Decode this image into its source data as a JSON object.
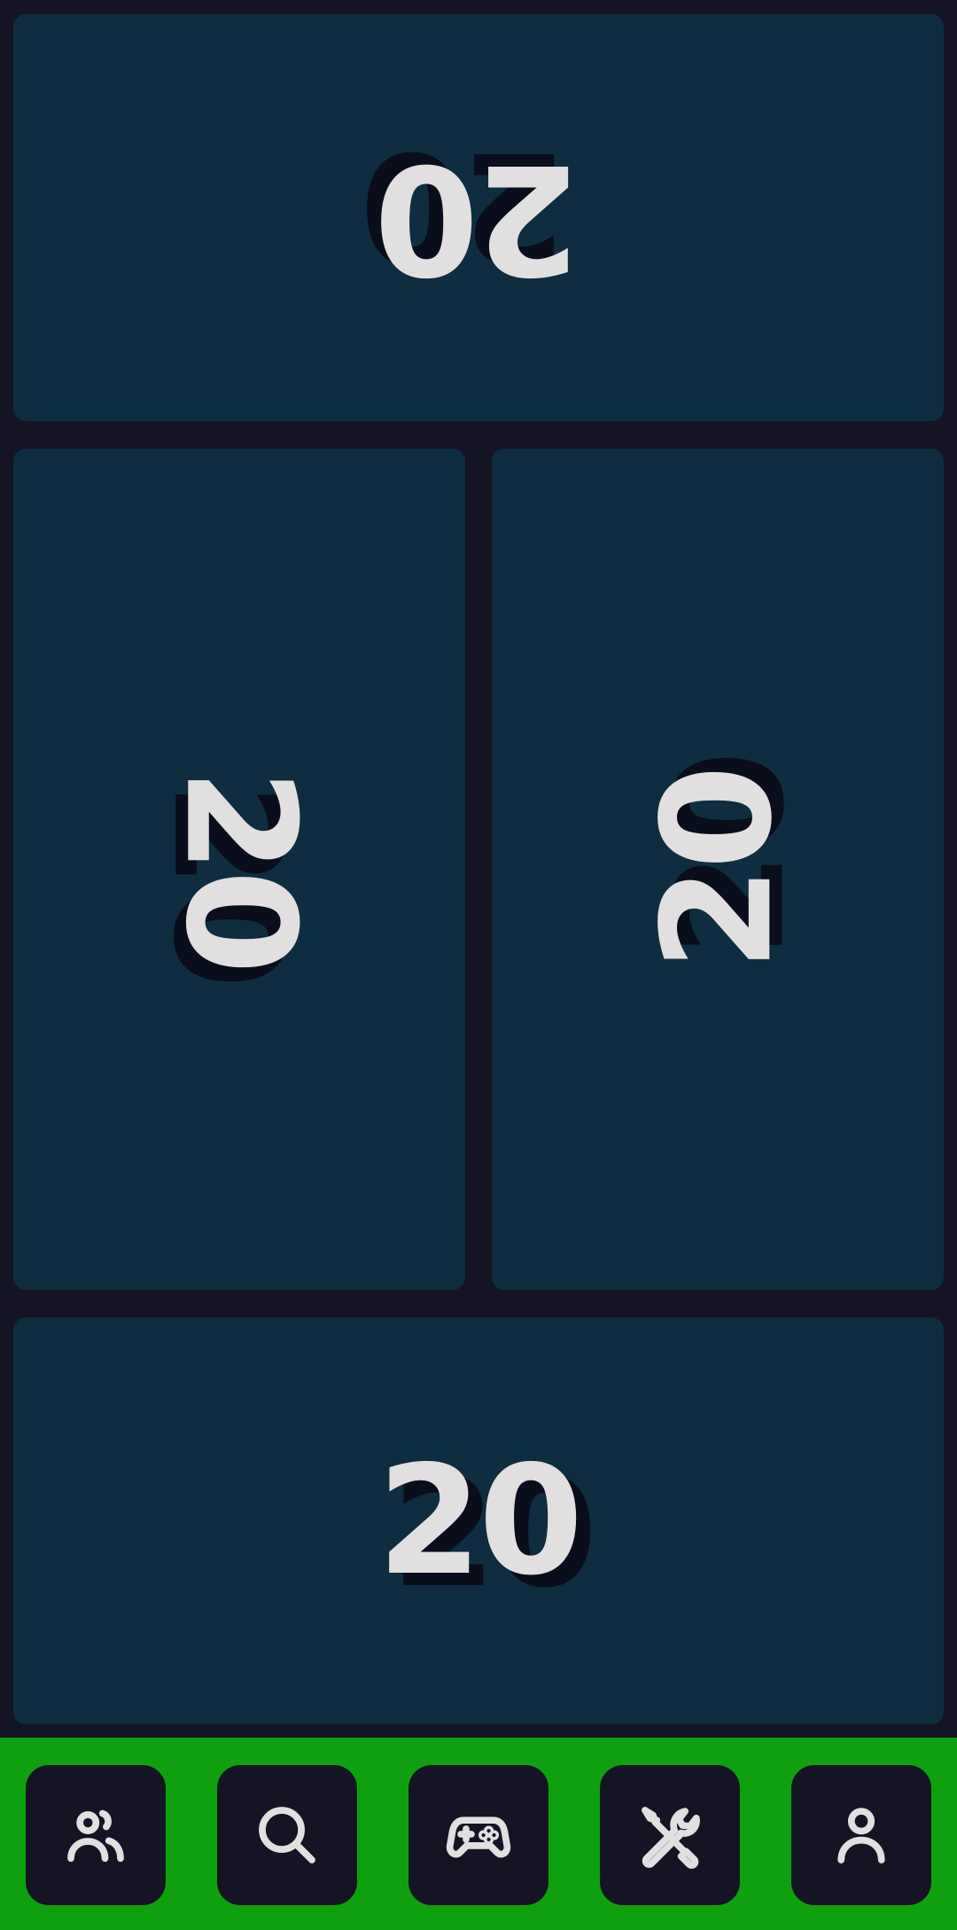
{
  "players": [
    {
      "id": "top",
      "life": "20",
      "orientation": "rotated-180"
    },
    {
      "id": "left",
      "life": "20",
      "orientation": "rotated-90"
    },
    {
      "id": "right",
      "life": "20",
      "orientation": "rotated-270"
    },
    {
      "id": "bottom",
      "life": "20",
      "orientation": "upright"
    }
  ],
  "nav": [
    {
      "icon": "users-icon"
    },
    {
      "icon": "search-icon"
    },
    {
      "icon": "gamepad-icon"
    },
    {
      "icon": "tools-icon"
    },
    {
      "icon": "user-icon"
    }
  ],
  "colors": {
    "background": "#141424",
    "panel": "#0e2d40",
    "text": "#e1dfe0",
    "nav_bar": "#0fa00f",
    "nav_button": "#141424"
  }
}
